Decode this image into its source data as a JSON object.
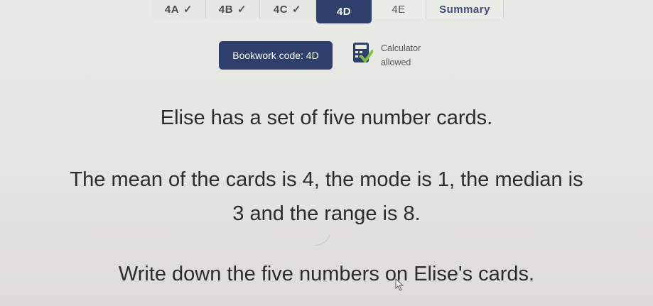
{
  "tabs": [
    {
      "label": "4A",
      "state": "done",
      "icon": "check-icon"
    },
    {
      "label": "4B",
      "state": "done",
      "icon": "check-icon"
    },
    {
      "label": "4C",
      "state": "done",
      "icon": "check-icon"
    },
    {
      "label": "4D",
      "state": "active"
    },
    {
      "label": "4E",
      "state": "pending"
    },
    {
      "label": "Summary",
      "state": "summary"
    }
  ],
  "check_glyph": "✓",
  "bookwork": {
    "label": "Bookwork code: 4D"
  },
  "calculator": {
    "line1": "Calculator",
    "line2": "allowed",
    "icon": "calculator-icon"
  },
  "question": {
    "line1": "Elise has a set of five number cards.",
    "line2": "The mean of the cards is 4, the mode is 1, the median is",
    "line3": "3 and the range is 8.",
    "line4": "Write down the five numbers on Elise's cards."
  },
  "colors": {
    "brand": "#2f3f6b",
    "summary_text": "#3f4f7e",
    "calc_green": "#7bbf3a"
  }
}
